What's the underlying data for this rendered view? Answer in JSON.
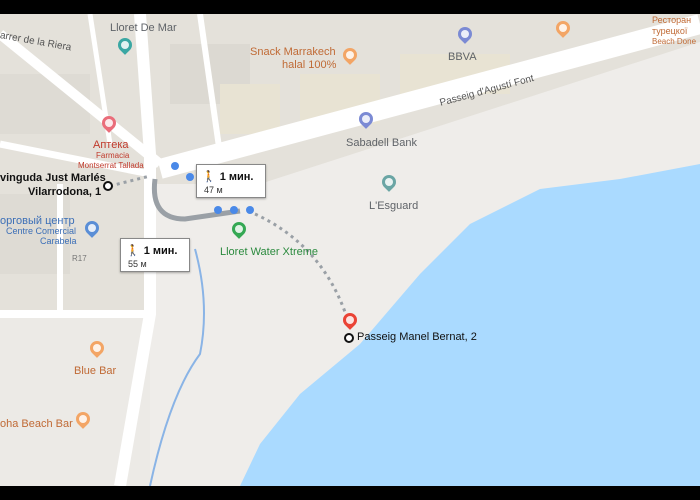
{
  "labels": {
    "lloret_de_mar": "Lloret De Mar",
    "carrer_riera": "arrer de la Riera",
    "snack_line1": "Snack Marrakech",
    "snack_line2": "halal 100%",
    "bbva": "BBVA",
    "restaurant_line1": "Ресторан",
    "restaurant_line2": "турецкої",
    "restaurant_line3": "Beach Done",
    "passeig_agusti": "Passeig d'Agustí Font",
    "pharmacy_line1": "Аптека",
    "pharmacy_line2": "Farmacia",
    "pharmacy_line3": "Montserrat Tallada",
    "sabadell": "Sabadell Bank",
    "esguard": "L'Esguard",
    "origin_line1": "vinguda Just Marlés",
    "origin_line2": "Vilarrodona, 1",
    "shopping_line1": "орговый центр",
    "shopping_line2": "Centre Comercial",
    "shopping_line3": "Carabela",
    "r17": "R17",
    "water_xtreme": "Lloret Water Xtreme",
    "destination": "Passeig Manel Bernat, 2",
    "blue_bar": "Blue Bar",
    "aloha": "oha Beach Bar"
  },
  "callouts": {
    "top": {
      "time": "1 мин.",
      "distance": "47 м"
    },
    "bottom": {
      "time": "1 мин.",
      "distance": "55 м"
    }
  },
  "colors": {
    "sea": "#aadaff",
    "route": "#4a89e8",
    "destination_pin": "#ea4335",
    "road": "#ffffff",
    "building": "#e0ddd6"
  },
  "icons": {
    "walker": "pedestrian-icon"
  }
}
